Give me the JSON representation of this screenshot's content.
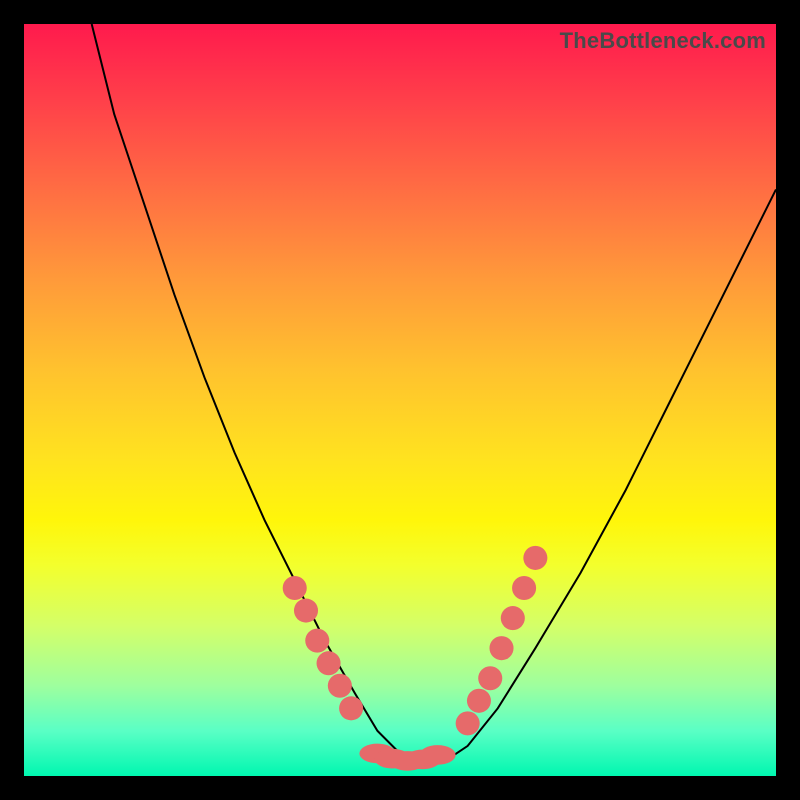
{
  "watermark": "TheBottleneck.com",
  "chart_data": {
    "type": "line",
    "title": "",
    "xlabel": "",
    "ylabel": "",
    "xlim": [
      0,
      100
    ],
    "ylim": [
      0,
      100
    ],
    "curve": {
      "name": "bottleneck-curve",
      "x": [
        9,
        12,
        16,
        20,
        24,
        28,
        32,
        36,
        40,
        44,
        47,
        50,
        53,
        56,
        59,
        63,
        68,
        74,
        80,
        86,
        92,
        100
      ],
      "y": [
        100,
        88,
        76,
        64,
        53,
        43,
        34,
        26,
        18,
        11,
        6,
        3,
        2,
        2,
        4,
        9,
        17,
        27,
        38,
        50,
        62,
        78
      ]
    },
    "markers_left": {
      "name": "left-cluster",
      "x": [
        36,
        37.5,
        39,
        40.5,
        42,
        43.5
      ],
      "y": [
        25,
        22,
        18,
        15,
        12,
        9
      ]
    },
    "markers_bottom": {
      "name": "bottom-cluster",
      "x": [
        47,
        49,
        51,
        53,
        55
      ],
      "y": [
        3,
        2.3,
        2,
        2.2,
        2.8
      ]
    },
    "markers_right": {
      "name": "right-cluster",
      "x": [
        59,
        60.5,
        62,
        63.5,
        65,
        66.5,
        68
      ],
      "y": [
        7,
        10,
        13,
        17,
        21,
        25,
        29
      ]
    },
    "marker_radius_pct": 1.6,
    "bottom_marker_rx_pct": 2.4,
    "bottom_marker_ry_pct": 1.3
  }
}
